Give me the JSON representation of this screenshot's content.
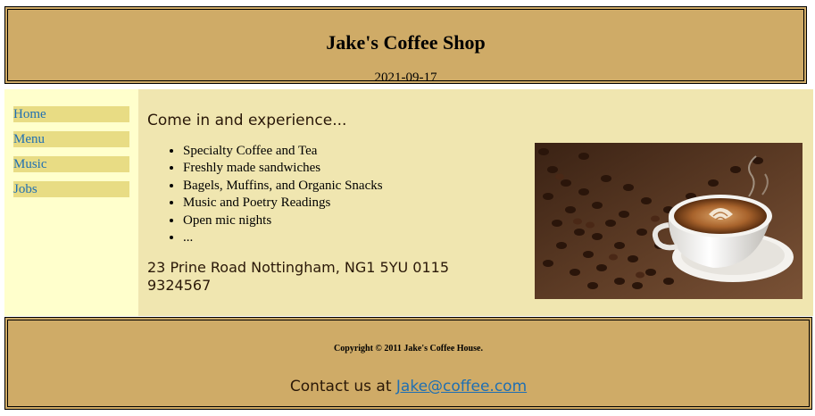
{
  "header": {
    "title": "Jake's Coffee Shop",
    "date": "2021-09-17"
  },
  "nav": {
    "items": [
      {
        "label": "Home"
      },
      {
        "label": "Menu"
      },
      {
        "label": "Music"
      },
      {
        "label": "Jobs"
      }
    ]
  },
  "main": {
    "intro": "Come in and experience...",
    "features": [
      "Specialty Coffee and Tea",
      "Freshly made sandwiches",
      "Bagels, Muffins, and Organic Snacks",
      "Music and Poetry Readings",
      "Open mic nights",
      "..."
    ],
    "address": "23 Prine Road Nottingham, NG1 5YU 0115 9324567"
  },
  "footer": {
    "copyright": "Copyright © 2011 Jake's Coffee House.",
    "contact_prefix": "Contact us at",
    "contact_email": "Jake@coffee.com"
  },
  "colors": {
    "header_bg": "#cfab67",
    "sidebar_bg": "#ffffcc",
    "main_bg": "#f0e6b0",
    "nav_item_bg": "#e8dc84",
    "link": "#1f6fb2"
  }
}
